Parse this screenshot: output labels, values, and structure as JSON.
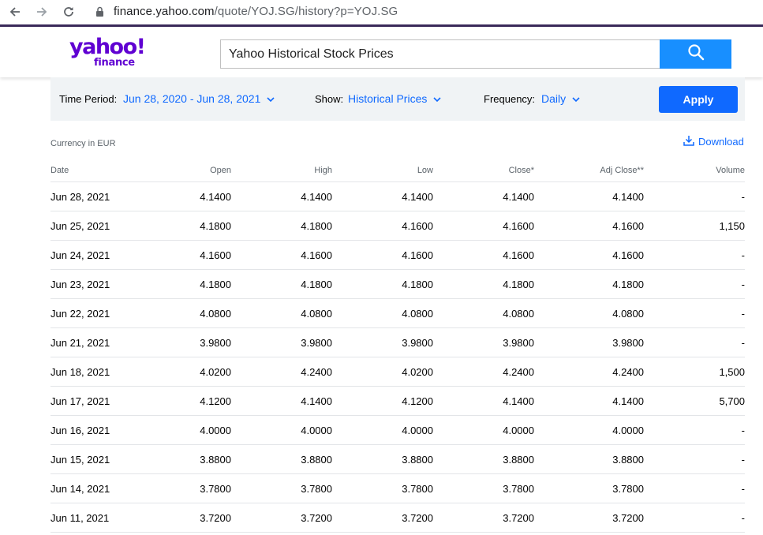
{
  "browser": {
    "url_host": "finance.yahoo.com",
    "url_path": "/quote/YOJ.SG/history?p=YOJ.SG"
  },
  "header": {
    "logo_top": "yahoo!",
    "logo_bottom": "finance",
    "search_value": "Yahoo Historical Stock Prices",
    "brand_color": "#6001d2",
    "search_button_color": "#188fff"
  },
  "filters": {
    "time_period_label": "Time Period:",
    "time_period_value": "Jun 28, 2020 - Jun 28, 2021",
    "show_label": "Show:",
    "show_value": "Historical Prices",
    "frequency_label": "Frequency:",
    "frequency_value": "Daily",
    "apply_label": "Apply",
    "accent_color": "#0f69ff"
  },
  "meta": {
    "currency": "Currency in EUR",
    "download_label": "Download"
  },
  "table": {
    "headers": {
      "date": "Date",
      "open": "Open",
      "high": "High",
      "low": "Low",
      "close": "Close*",
      "adj_close": "Adj Close**",
      "volume": "Volume"
    },
    "rows": [
      {
        "date": "Jun 28, 2021",
        "open": "4.1400",
        "high": "4.1400",
        "low": "4.1400",
        "close": "4.1400",
        "adj_close": "4.1400",
        "volume": "-"
      },
      {
        "date": "Jun 25, 2021",
        "open": "4.1800",
        "high": "4.1800",
        "low": "4.1600",
        "close": "4.1600",
        "adj_close": "4.1600",
        "volume": "1,150"
      },
      {
        "date": "Jun 24, 2021",
        "open": "4.1600",
        "high": "4.1600",
        "low": "4.1600",
        "close": "4.1600",
        "adj_close": "4.1600",
        "volume": "-"
      },
      {
        "date": "Jun 23, 2021",
        "open": "4.1800",
        "high": "4.1800",
        "low": "4.1800",
        "close": "4.1800",
        "adj_close": "4.1800",
        "volume": "-"
      },
      {
        "date": "Jun 22, 2021",
        "open": "4.0800",
        "high": "4.0800",
        "low": "4.0800",
        "close": "4.0800",
        "adj_close": "4.0800",
        "volume": "-"
      },
      {
        "date": "Jun 21, 2021",
        "open": "3.9800",
        "high": "3.9800",
        "low": "3.9800",
        "close": "3.9800",
        "adj_close": "3.9800",
        "volume": "-"
      },
      {
        "date": "Jun 18, 2021",
        "open": "4.0200",
        "high": "4.2400",
        "low": "4.0200",
        "close": "4.2400",
        "adj_close": "4.2400",
        "volume": "1,500"
      },
      {
        "date": "Jun 17, 2021",
        "open": "4.1200",
        "high": "4.1400",
        "low": "4.1200",
        "close": "4.1400",
        "adj_close": "4.1400",
        "volume": "5,700"
      },
      {
        "date": "Jun 16, 2021",
        "open": "4.0000",
        "high": "4.0000",
        "low": "4.0000",
        "close": "4.0000",
        "adj_close": "4.0000",
        "volume": "-"
      },
      {
        "date": "Jun 15, 2021",
        "open": "3.8800",
        "high": "3.8800",
        "low": "3.8800",
        "close": "3.8800",
        "adj_close": "3.8800",
        "volume": "-"
      },
      {
        "date": "Jun 14, 2021",
        "open": "3.7800",
        "high": "3.7800",
        "low": "3.7800",
        "close": "3.7800",
        "adj_close": "3.7800",
        "volume": "-"
      },
      {
        "date": "Jun 11, 2021",
        "open": "3.7200",
        "high": "3.7200",
        "low": "3.7200",
        "close": "3.7200",
        "adj_close": "3.7200",
        "volume": "-"
      }
    ]
  }
}
